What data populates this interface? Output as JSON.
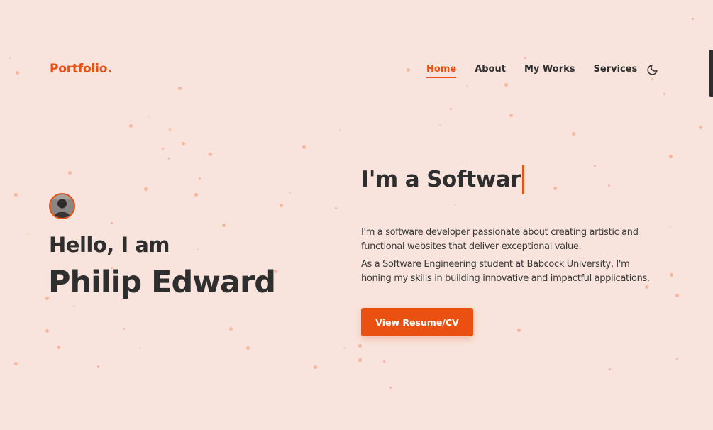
{
  "brand": {
    "logo": "Portfolio."
  },
  "nav": {
    "items": [
      {
        "label": "Home",
        "active": true
      },
      {
        "label": "About",
        "active": false
      },
      {
        "label": "My Works",
        "active": false
      },
      {
        "label": "Services",
        "active": false
      }
    ],
    "theme_toggle_icon": "moon-icon"
  },
  "hero": {
    "greeting": "Hello, I am",
    "name": "Philip Edward",
    "avatar_icon": "profile-photo",
    "typed_text": "I'm a Softwar",
    "paragraph_1": "I'm a software developer passionate about creating artistic and functional websites that deliver exceptional value.",
    "paragraph_2": "As a Software Engineering student at Babcock University, I'm honing my skills in building innovative and impactful applications.",
    "cta_label": "View Resume/CV"
  },
  "colors": {
    "accent": "#ea5012",
    "background": "#f8e4dc",
    "text": "#2e2e2e",
    "particle": "#f6b79e"
  }
}
